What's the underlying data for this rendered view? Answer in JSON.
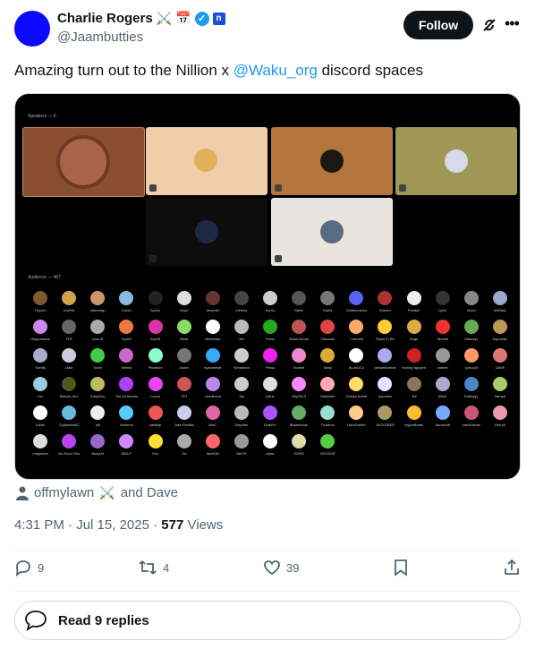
{
  "author": {
    "name": "Charlie Rogers",
    "badges": [
      "⚔️",
      "📅"
    ],
    "org_badge": "n",
    "handle": "@Jaambutties",
    "follow_label": "Follow"
  },
  "tweet": {
    "text_before": "Amazing turn out to the Nillion x ",
    "mention": "@Waku_org",
    "text_after": " discord spaces"
  },
  "media": {
    "speakers_label": "Speakers — 6",
    "audience_label": "Audience — 467",
    "audience_names": [
      "Thyxon",
      "Iewfha",
      "intonrnap",
      "Kyron",
      "Synoz",
      "Veylo",
      "desedia",
      "medow",
      "Kyros",
      "Rynix",
      "Kaela",
      "Goldenmeow",
      "Draven",
      "Freakin",
      "Lynis",
      "Zeavr",
      "McBasz",
      "dragonsona",
      "TCP",
      "Ivan AI",
      "JoyXD",
      "Keyhill",
      "Relai",
      "Yeovreder",
      "Jiro",
      "Fame",
      "Asha Kumar",
      "Osmosis",
      "I Jamebi",
      "Super D Re",
      "Doge",
      "Tanned",
      "Marcoyz",
      "Sapoman",
      "Kohitij",
      "Liam",
      "Kane",
      "Alexist",
      "Phantom",
      "Jadex",
      "Ilyandrewti",
      "Yphantom",
      "Pessy",
      "Scarlet",
      "Abby",
      "BLueLiCu",
      "pensethomas",
      "Hoang Nguyen",
      "zaheer",
      "jumuoid",
      "DAVE",
      "Leo",
      "Mubah_dev",
      "EasyGuy",
      "The ph barney",
      "Lupus",
      "TE3",
      "peanikona",
      "Joy",
      "julius",
      "billy3413",
      "Sidwines",
      "Cristyo Arche",
      "popness",
      "Jeli",
      "jBlue",
      "Bubbyyy",
      "haruya",
      "tukhli",
      "Cryptotera87",
      "pifi",
      "Arbimon",
      "webslip",
      "Jake Peralta",
      "WoC",
      "Stephen",
      "DrakHV",
      "Blackshoop",
      "Foxstrox",
      "HardGamer",
      "JACKOBEE",
      "cryptoBraav",
      "Jacobxott",
      "zanduskow",
      "Derryd",
      "rongwoan",
      "Nu Khon San",
      "NickyJo",
      "MDLF",
      "Osv",
      "Olu",
      "tamiON",
      "MeCR",
      "milan",
      "SONG",
      "VINTAGE"
    ],
    "audience_colors": [
      "#7b5b2b",
      "#d4a24c",
      "#c96",
      "#8fb8e0",
      "#222",
      "#ddd",
      "#633",
      "#444",
      "#ccc",
      "#555",
      "#777",
      "#5865f2",
      "#a33",
      "#eee",
      "#333",
      "#888",
      "#9ac",
      "#c8e",
      "#666",
      "#aaa",
      "#e74",
      "#d3a",
      "#8d6",
      "#fff",
      "#bbb",
      "#2a2",
      "#b55",
      "#d44",
      "#fa6",
      "#fc3",
      "#da4",
      "#e33",
      "#6a5",
      "#b95",
      "#aac",
      "#ccd",
      "#4c4",
      "#c6c",
      "#8fc",
      "#777",
      "#3af",
      "#ccc",
      "#e2e",
      "#e8c",
      "#da3",
      "#fff",
      "#aae",
      "#c22",
      "#999",
      "#f96",
      "#d77",
      "#9cd",
      "#552",
      "#bb6",
      "#a4f",
      "#e4e",
      "#c55",
      "#b8e",
      "#ccc",
      "#ddd",
      "#f8f",
      "#fab",
      "#fd6",
      "#edf",
      "#875",
      "#aac",
      "#48c",
      "#ac6",
      "#fff",
      "#6bd",
      "#eee",
      "#5cf",
      "#e55",
      "#cce",
      "#d6a",
      "#bbb",
      "#a5f",
      "#6a6",
      "#9dc",
      "#fc8",
      "#a96",
      "#fb3",
      "#7af",
      "#c57",
      "#e9a",
      "#ddd",
      "#b4e",
      "#96c",
      "#c8f",
      "#fd3",
      "#aaa",
      "#f66",
      "#999",
      "#fff",
      "#dda",
      "#5c4"
    ]
  },
  "tagged": {
    "user": "offmylawn",
    "badge": "⚔️",
    "suffix": "and Dave"
  },
  "meta": {
    "time": "4:31 PM",
    "date": "Jul 15, 2025",
    "views_count": "577",
    "views_label": "Views"
  },
  "actions": {
    "replies": "9",
    "reposts": "4",
    "likes": "39"
  },
  "read_replies_label": "Read 9 replies"
}
